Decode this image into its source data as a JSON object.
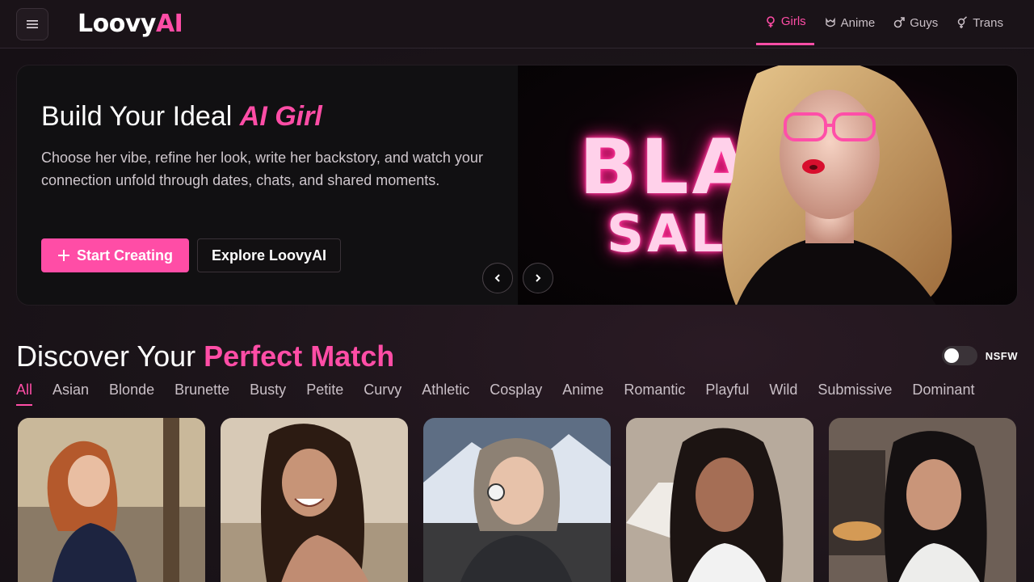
{
  "header": {
    "logo_main": "Loovy",
    "logo_accent": "AI",
    "nav": [
      {
        "label": "Girls",
        "icon": "female-icon",
        "active": true
      },
      {
        "label": "Anime",
        "icon": "anime-icon",
        "active": false
      },
      {
        "label": "Guys",
        "icon": "male-icon",
        "active": false
      },
      {
        "label": "Trans",
        "icon": "trans-icon",
        "active": false
      }
    ]
  },
  "hero": {
    "title_prefix": "Build Your Ideal ",
    "title_accent": "AI Girl",
    "description": "Choose her vibe, refine her look, write her backstory, and watch your connection unfold through dates, chats, and shared moments.",
    "primary_button": "Start Creating",
    "secondary_button": "Explore LoovyAI",
    "banner_line1": "BLACK",
    "banner_line2": "SALE"
  },
  "discover": {
    "title_prefix": "Discover Your ",
    "title_accent": "Perfect Match",
    "nsfw_label": "NSFW",
    "nsfw_enabled": false,
    "filters": [
      "All",
      "Asian",
      "Blonde",
      "Brunette",
      "Busty",
      "Petite",
      "Curvy",
      "Athletic",
      "Cosplay",
      "Anime",
      "Romantic",
      "Playful",
      "Wild",
      "Submissive",
      "Dominant"
    ],
    "active_filter": "All"
  },
  "colors": {
    "accent": "#ff4da6",
    "background": "#1b1419"
  }
}
